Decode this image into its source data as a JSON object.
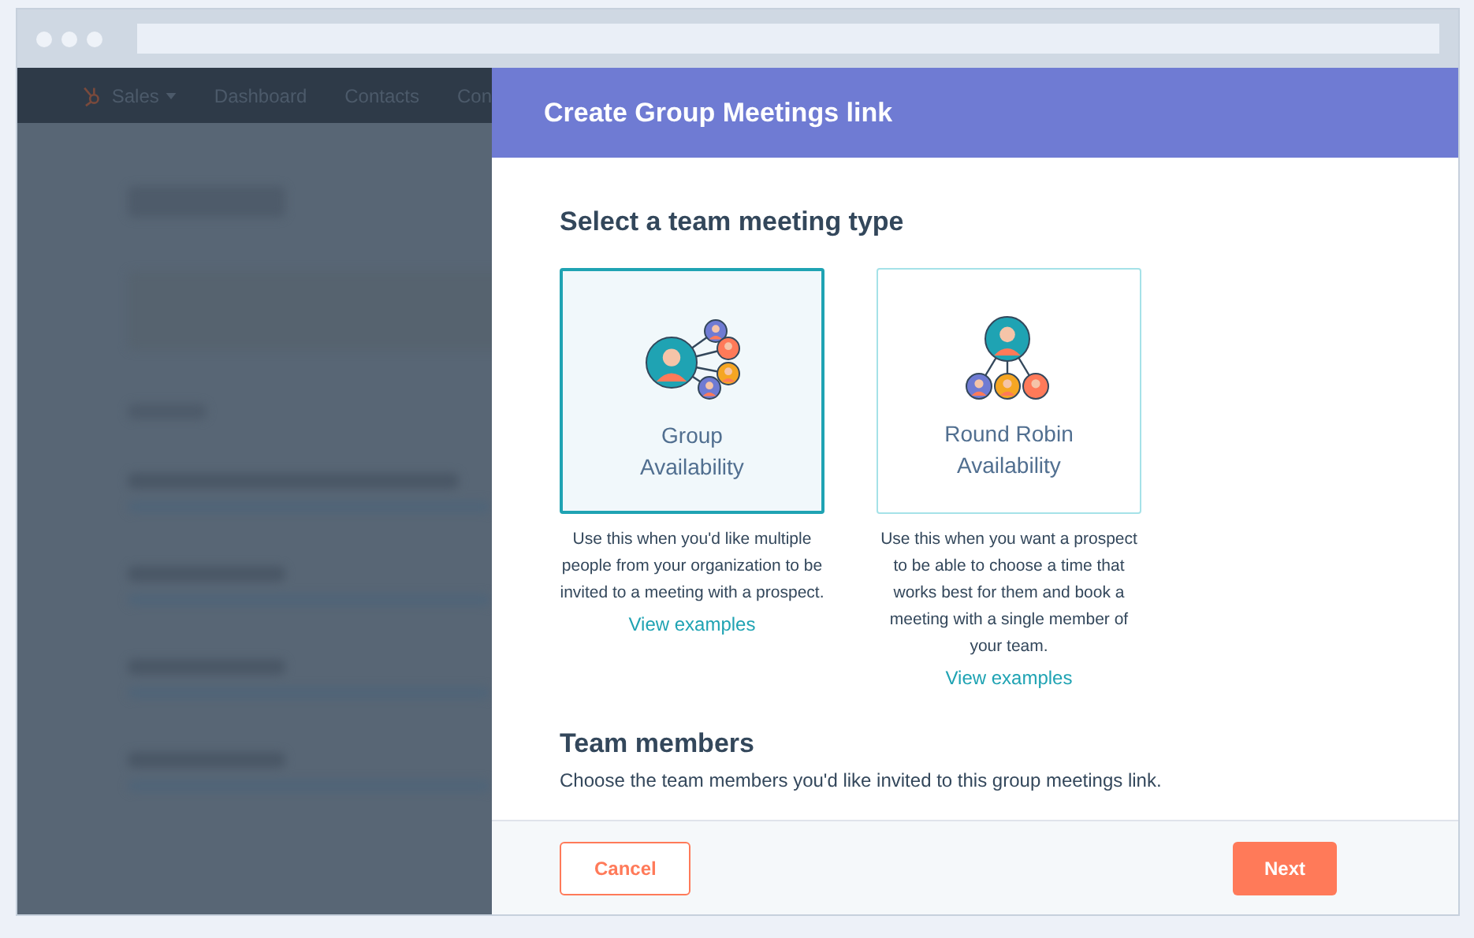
{
  "nav": {
    "items": [
      {
        "label": "Sales",
        "dropdown": true
      },
      {
        "label": "Dashboard",
        "dropdown": false
      },
      {
        "label": "Contacts",
        "dropdown": false
      },
      {
        "label": "Con",
        "dropdown": false
      }
    ]
  },
  "modal": {
    "title": "Create Group Meetings link",
    "section_title": "Select a team meeting type",
    "meeting_types": [
      {
        "kind": "group",
        "title": "Group Availability",
        "description": "Use this when you'd like multiple people from your organization to be invited to a meeting with a prospect.",
        "link": "View examples",
        "selected": true
      },
      {
        "kind": "round_robin",
        "title": "Round Robin Availability",
        "description": "Use this when you want a prospect to be able to choose a time that works best for them and book a meeting with a single member of your team.",
        "link": "View examples",
        "selected": false
      }
    ],
    "team_section": {
      "title": "Team members",
      "description": "Choose the team members you'd like invited to this group meetings link."
    },
    "buttons": [
      {
        "label": "Cancel",
        "kind": "secondary"
      },
      {
        "label": "Next",
        "kind": "primary"
      }
    ]
  }
}
